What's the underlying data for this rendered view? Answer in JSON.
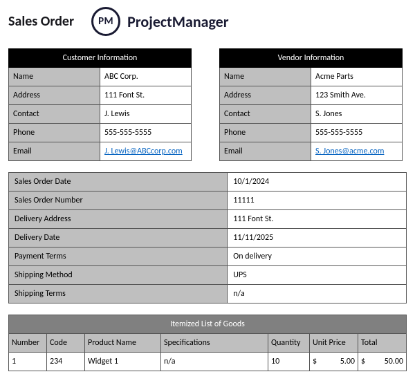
{
  "title": "Sales Order",
  "brand": {
    "logo_initials": "PM",
    "name": "ProjectManager"
  },
  "customer": {
    "heading": "Customer Information",
    "name_label": "Name",
    "name": "ABC Corp.",
    "address_label": "Address",
    "address": "111 Font St.",
    "contact_label": "Contact",
    "contact": "J. Lewis",
    "phone_label": "Phone",
    "phone": "555-555-5555",
    "email_label": "Email",
    "email": "J. Lewis@ABCcorp.com"
  },
  "vendor": {
    "heading": "Vendor Information",
    "name_label": "Name",
    "name": "Acme Parts",
    "address_label": "Address",
    "address": "123 Smith Ave.",
    "contact_label": "Contact",
    "contact": "S. Jones",
    "phone_label": "Phone",
    "phone": "555-555-5555",
    "email_label": "Email",
    "email": "S. Jones@acme.com"
  },
  "details": {
    "date_label": "Sales Order Date",
    "date": "10/1/2024",
    "number_label": "Sales Order Number",
    "number": "11111",
    "delivery_addr_label": "Delivery Address",
    "delivery_addr": "111 Font St.",
    "delivery_date_label": "Delivery Date",
    "delivery_date": "11/11/2025",
    "payment_label": "Payment Terms",
    "payment": "On delivery",
    "shipping_method_label": "Shipping Method",
    "shipping_method": "UPS",
    "shipping_terms_label": "Shipping Terms",
    "shipping_terms": "n/a"
  },
  "items": {
    "heading": "Itemized List of Goods",
    "cols": {
      "number": "Number",
      "code": "Code",
      "product": "Product Name",
      "spec": "Specifications",
      "qty": "Quantity",
      "unit": "Unit Price",
      "total": "Total"
    },
    "rows": [
      {
        "number": "1",
        "code": "234",
        "product": "Widget 1",
        "spec": "n/a",
        "qty": "10",
        "unit_currency": "$",
        "unit": "5.00",
        "total_currency": "$",
        "total": "50.00"
      }
    ]
  }
}
